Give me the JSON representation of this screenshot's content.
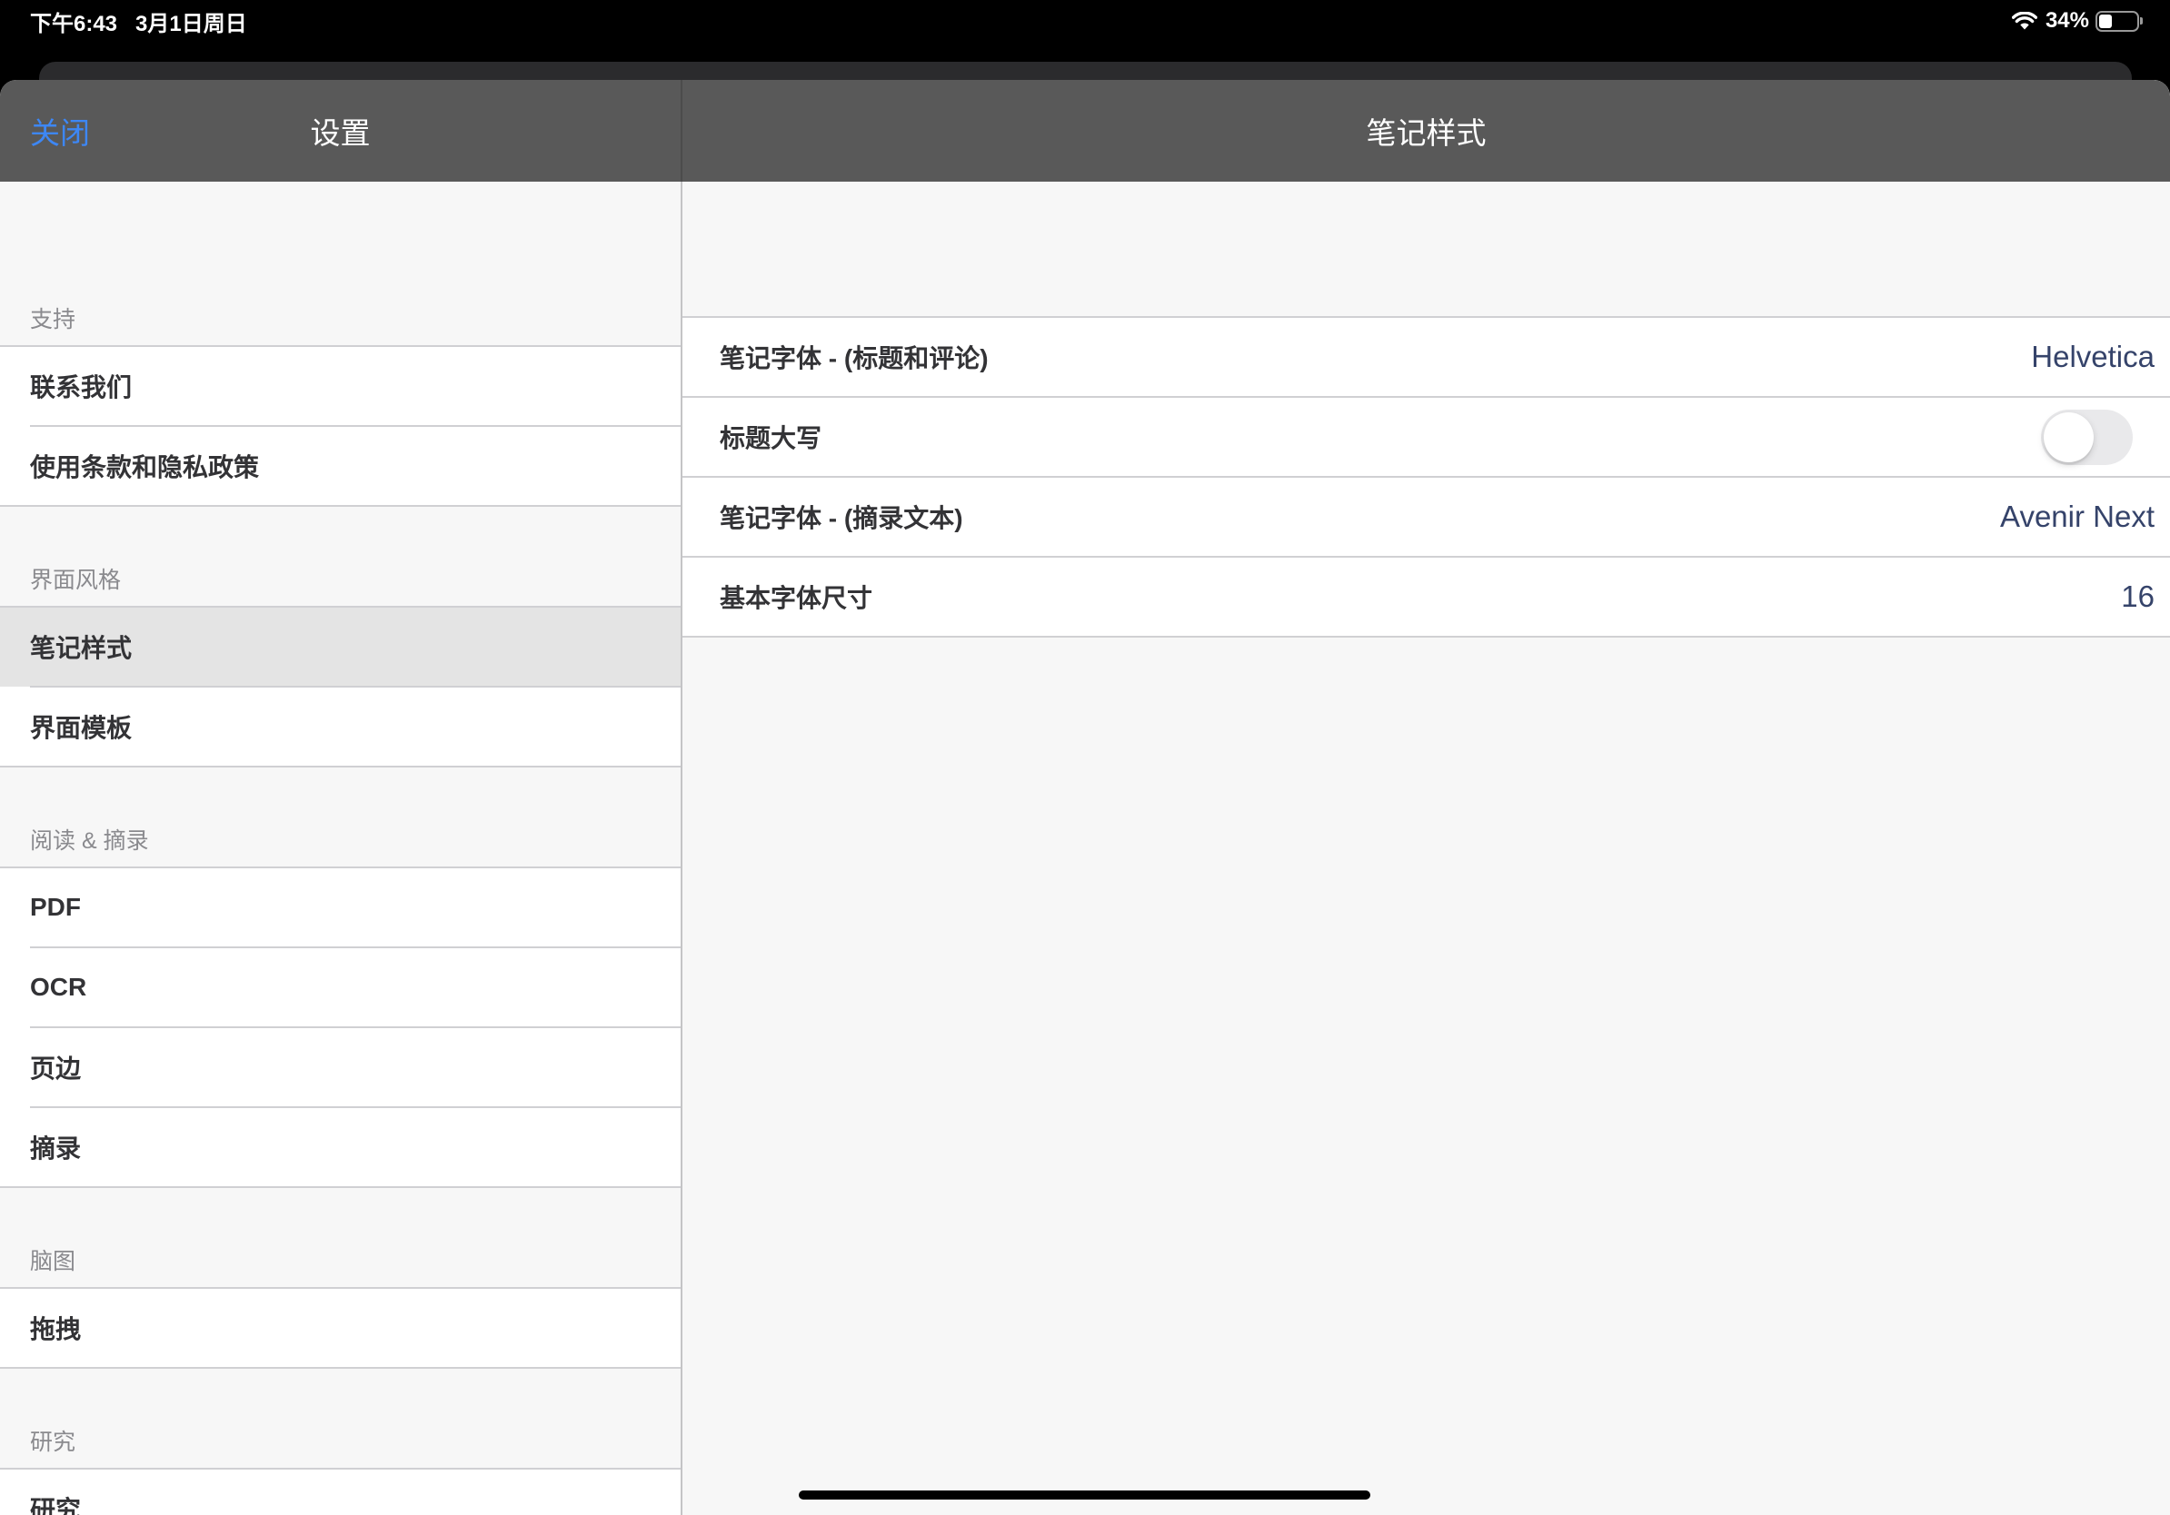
{
  "status_bar": {
    "time": "下午6:43",
    "date": "3月1日周日",
    "battery": "34%",
    "battery_level": 34,
    "icons": {
      "wifi": "wifi-icon",
      "battery": "battery-icon"
    }
  },
  "sidebar": {
    "close_label": "关闭",
    "title": "设置",
    "sections": [
      {
        "header": "支持",
        "items": [
          {
            "label": "联系我们"
          },
          {
            "label": "使用条款和隐私政策"
          }
        ]
      },
      {
        "header": "界面风格",
        "items": [
          {
            "label": "笔记样式",
            "selected": true
          },
          {
            "label": "界面模板"
          }
        ]
      },
      {
        "header": "阅读 & 摘录",
        "items": [
          {
            "label": "PDF"
          },
          {
            "label": "OCR"
          },
          {
            "label": "页边"
          },
          {
            "label": "摘录"
          }
        ]
      },
      {
        "header": "脑图",
        "items": [
          {
            "label": "拖拽"
          }
        ]
      },
      {
        "header": "研究",
        "items": [
          {
            "label": "研究"
          }
        ]
      }
    ]
  },
  "detail": {
    "title": "笔记样式",
    "rows": [
      {
        "label": "笔记字体 - (标题和评论)",
        "value": "Helvetica"
      },
      {
        "label": "标题大写",
        "toggle_on": false
      },
      {
        "label": "笔记字体 - (摘录文本)",
        "value": "Avenir Next"
      },
      {
        "label": "基本字体尺寸",
        "value": "16"
      }
    ]
  },
  "colors": {
    "accent": "#3d87f5",
    "nav": "#595959",
    "value": "#35436a",
    "selected": "#e4e4e4",
    "toggle-off": "#e9e9eb"
  }
}
